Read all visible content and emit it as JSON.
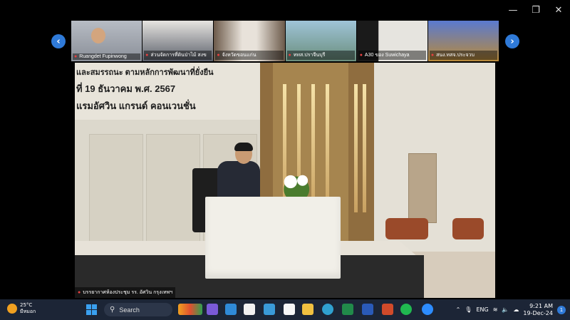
{
  "participants": [
    {
      "name": "Ruangdet Fupinwong",
      "bg": "#8a8f98"
    },
    {
      "name": "ส่วนจัดการที่ดินป่าไม้ สงข",
      "bg": "#5a5f6a"
    },
    {
      "name": "จังหวัดขอนแก่น",
      "bg": "#6c5a4a"
    },
    {
      "name": "ททส.ปราจีนบุรี",
      "bg": "#6a8e7c"
    },
    {
      "name": "A30 ของ Suwichaya",
      "bg": "#4a4e58"
    },
    {
      "name": "สนง.ทสจ.ประจวบ",
      "bg": "#b98a3a"
    }
  ],
  "banner": {
    "line1": "และสมรรถนะ ตามหลักการพัฒนาที่ยั่งยืน",
    "line2": "ที่ 19 ธันวาคม พ.ศ. 2567",
    "line3": "แรมอัศวิน แกรนด์ คอนเวนชั่น"
  },
  "main_video_label": "บรรยากาศห้องประชุม รร. อัศวิน กรุงเทพฯ",
  "taskbar": {
    "temperature": "25°C",
    "weather": "มีหมอก",
    "search_label": "Search",
    "language": "ENG",
    "time": "9:21 AM",
    "date": "19-Dec-24",
    "notifications": "1"
  },
  "window_controls": [
    "—",
    "❐",
    "✕"
  ],
  "colors": {
    "accent": "#2f7ad8",
    "taskbar": "#1c2536"
  }
}
